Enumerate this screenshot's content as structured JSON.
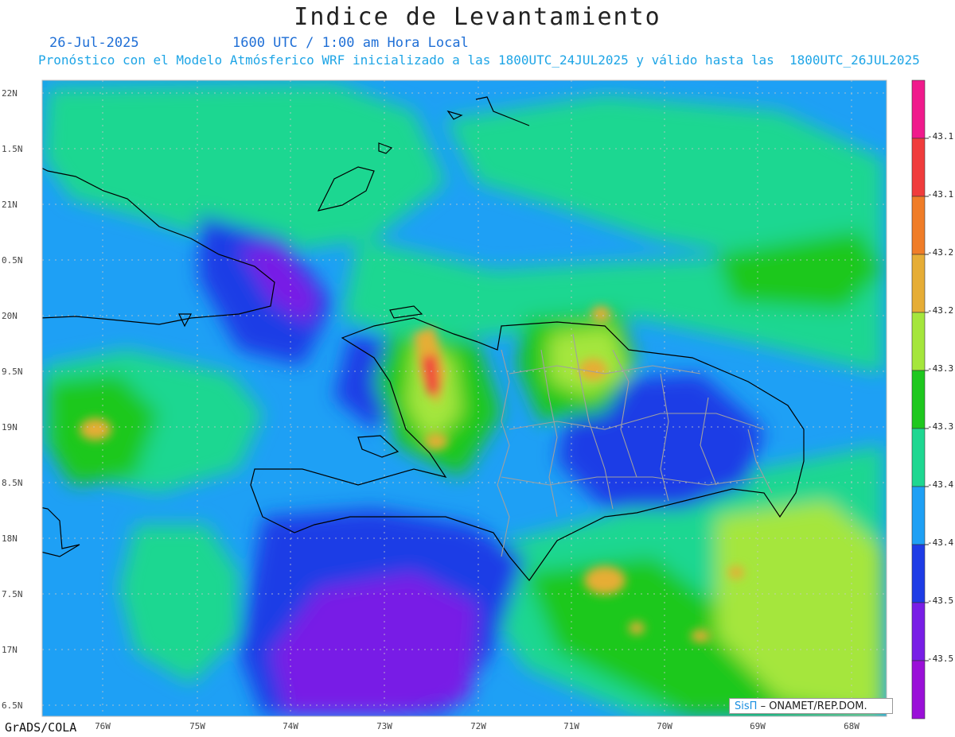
{
  "header": {
    "title": "Indice de Levantamiento",
    "date": "26-Jul-2025",
    "time": "1600 UTC / 1:00 am Hora Local",
    "description": "Pronóstico con el Modelo Atmósferico WRF inicializado a las 1800UTC_24JUL2025 y válido hasta las  1800UTC_26JUL2025"
  },
  "map": {
    "lat_labels": [
      "22N",
      "1.5N",
      "21N",
      "0.5N",
      "20N",
      "9.5N",
      "19N",
      "8.5N",
      "18N",
      "7.5N",
      "17N",
      "6.5N"
    ],
    "lon_labels": [
      "76W",
      "75W",
      "74W",
      "73W",
      "72W",
      "71W",
      "70W",
      "69W",
      "68W"
    ]
  },
  "colorbar": {
    "labels": [
      "-43.1",
      "-43.1",
      "-43.2",
      "-43.2",
      "-43.3",
      "-43.3",
      "-43.4",
      "-43.4",
      "-43.5",
      "-43.5"
    ],
    "colors": [
      "#f01a8c",
      "#f03c3c",
      "#f07d28",
      "#e6ad36",
      "#a5e63c",
      "#1ec81e",
      "#1ed791",
      "#1ea0f5",
      "#1e3ce6",
      "#781ee6",
      "#9a10d8"
    ]
  },
  "logo": {
    "brand": "SisΠ",
    "text": "– ONAMET/REP.DOM."
  },
  "footer": {
    "credit": "GrADS/COLA"
  }
}
